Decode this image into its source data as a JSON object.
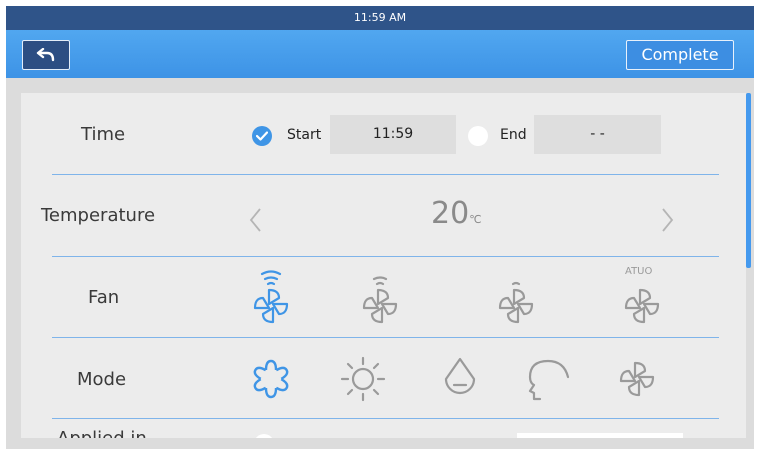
{
  "status_bar": {
    "time": "11:59 AM"
  },
  "header": {
    "complete_label": "Complete"
  },
  "rows": {
    "time": {
      "label": "Time",
      "start_label": "Start",
      "start_value": "11:59",
      "start_checked": true,
      "end_label": "End",
      "end_value": "- -",
      "end_checked": false
    },
    "temperature": {
      "label": "Temperature",
      "value": "20",
      "unit": "℃"
    },
    "fan": {
      "label": "Fan",
      "options": [
        "fan-high-icon",
        "fan-medium-icon",
        "fan-low-icon",
        "fan-auto-icon"
      ],
      "selected": "fan-high-icon",
      "auto_label": "ATUO"
    },
    "mode": {
      "label": "Mode",
      "options": [
        "snowflake-icon",
        "sun-icon",
        "drop-icon",
        "wind-icon",
        "fan-icon"
      ],
      "selected": "snowflake-icon"
    },
    "applied": {
      "label": "Applied in"
    }
  },
  "colors": {
    "accent": "#3f95e6",
    "status_bar": "#2f5489",
    "title_bar": "#4aa0ee",
    "panel": "#ececec",
    "inactive_icon": "#9a9a9a"
  }
}
